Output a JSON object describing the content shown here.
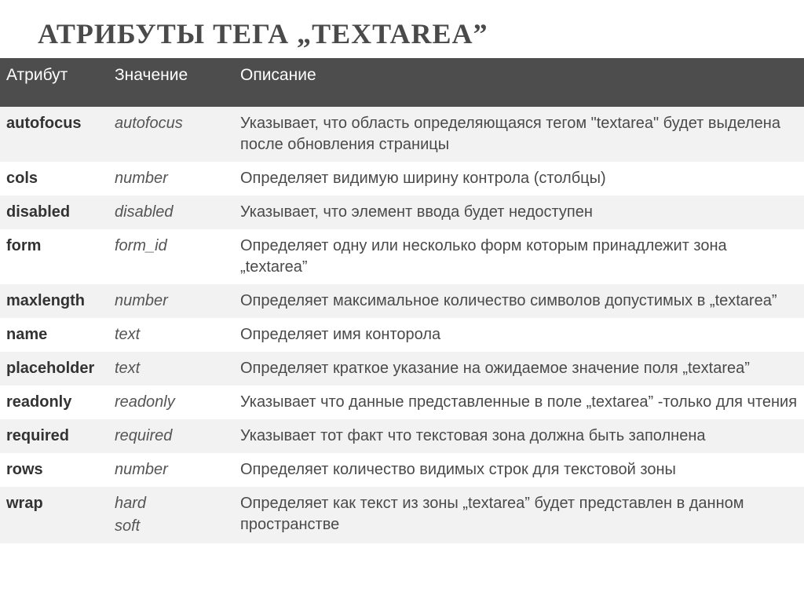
{
  "title": "АТРИБУТЫ ТЕГА  „TEXTAREA”",
  "columns": {
    "c1": "Атрибут",
    "c2": "Значение",
    "c3": "Описание"
  },
  "rows": [
    {
      "attr": "autofocus",
      "val": "autofocus",
      "desc": "Указывает, что область определяющаяся  тегом \"textarea\" будет выделена после обновления страницы"
    },
    {
      "attr": "cols",
      "val": "number",
      "desc": "Определяет видимую ширину контрола (столбцы)"
    },
    {
      "attr": "disabled",
      "val": "disabled",
      "desc": "Указывает, что элемент ввода будет недоступен"
    },
    {
      "attr": "form",
      "val": "form_id",
      "desc": "Определяет одну или несколько форм которым принадлежит зона  „textarea”"
    },
    {
      "attr": "maxlength",
      "val": "number",
      "desc": "Определяет максимальное количество символов допустимых в „textarea”"
    },
    {
      "attr": "name",
      "val": "text",
      "desc": "Определяет имя конторола"
    },
    {
      "attr": "placeholder",
      "val": "text",
      "desc": "Определяет  краткое указание на ожидаемое значение поля „textarea”"
    },
    {
      "attr": "readonly",
      "val": "readonly",
      "desc": "Указывает что данные представленные в поле „textarea” -только для чтения"
    },
    {
      "attr": "required",
      "val": "required",
      "desc": "Указывает тот факт что текстовая зона должна быть заполнена"
    },
    {
      "attr": "rows",
      "val": "number",
      "desc": "Определяет количество видимых строк для текстовой зоны"
    },
    {
      "attr": "wrap",
      "val": "hard",
      "val2": "soft",
      "desc": "Определяет как текст из зоны „textarea” будет представлен в данном пространстве"
    }
  ]
}
